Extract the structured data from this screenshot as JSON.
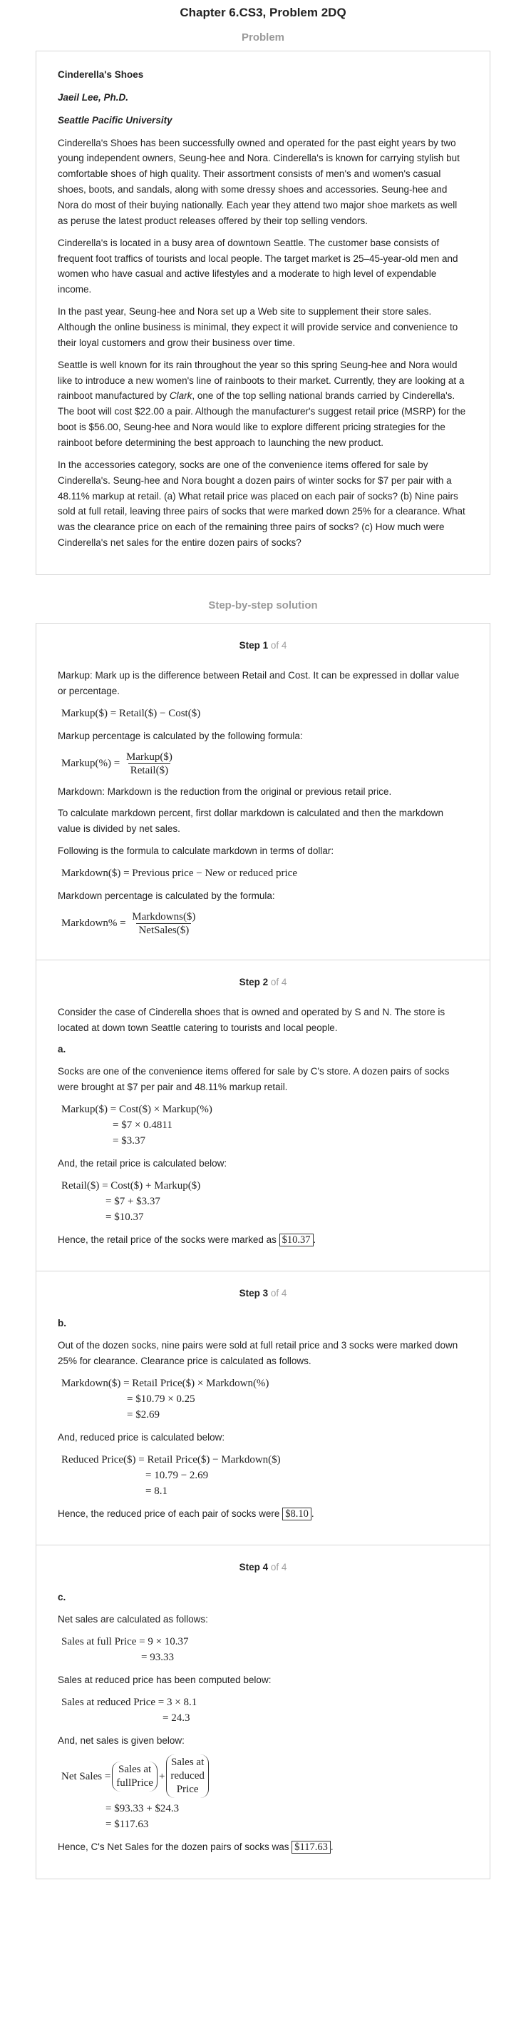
{
  "page_title": "Chapter 6.CS3, Problem 2DQ",
  "problem_heading": "Problem",
  "problem": {
    "title": "Cinderella's Shoes",
    "author": "Jaeil Lee, Ph.D.",
    "affiliation": "Seattle Pacific University",
    "p1": "Cinderella's Shoes has been successfully owned and operated for the past eight years by two young independent owners, Seung-hee and Nora. Cinderella's is known for carrying stylish but comfortable shoes of high quality. Their assortment consists of men's and women's casual shoes, boots, and sandals, along with some dressy shoes and accessories. Seung-hee and Nora do most of their buying nationally. Each year they attend two major shoe markets as well as peruse the latest product releases offered by their top selling vendors.",
    "p2": "Cinderella's is located in a busy area of downtown Seattle. The customer base consists of frequent foot traffics of tourists and local people. The target market is 25–45-year-old men and women who have casual and active lifestyles and a moderate to high level of expendable income.",
    "p3": "In the past year, Seung-hee and Nora set up a Web site to supplement their store sales. Although the online business is minimal, they expect it will provide service and convenience to their loyal customers and grow their business over time.",
    "p4a": "Seattle is well known for its rain throughout the year so this spring Seung-hee and Nora would like to introduce a new women's line of rainboots to their market. Currently, they are looking at a rainboot manufactured by ",
    "p4b": "Clark",
    "p4c": ", one of the top selling national brands carried by Cinderella's. The boot will cost $22.00 a pair. Although the manufacturer's suggest retail price (MSRP) for the boot is $56.00, Seung-hee and Nora would like to explore different pricing strategies for the rainboot before determining the best approach to launching the new product.",
    "p5": "In the accessories category, socks are one of the convenience items offered for sale by Cinderella's. Seung-hee and Nora bought a dozen pairs of winter socks for $7 per pair with a 48.11% markup at retail. (a) What retail price was placed on each pair of socks? (b) Nine pairs sold at full retail, leaving three pairs of socks that were marked down 25% for a clearance. What was the clearance price on each of the remaining three pairs of socks? (c) How much were Cinderella's net sales for the entire dozen pairs of socks?"
  },
  "solution_heading": "Step-by-step solution",
  "step_word": "Step",
  "step_of": "of 4",
  "steps": [
    {
      "num": "1",
      "t1": "Markup: Mark up is the difference between Retail and Cost. It can be expressed in dollar value or percentage.",
      "eq1": "Markup($) = Retail($) − Cost($)",
      "t2": "Markup percentage is calculated by the following formula:",
      "eq2_lhs": "Markup(%) =",
      "eq2_num": "Markup($)",
      "eq2_den": "Retail($)",
      "t3": "Markdown: Markdown is the reduction from the original or previous retail price.",
      "t4": "To calculate markdown percent, first dollar markdown is calculated and then the markdown value is divided by net sales.",
      "t5": "Following is the formula to calculate markdown in terms of dollar:",
      "eq3": "Markdown($) = Previous price − New or reduced price",
      "t6": "Markdown percentage is calculated by the formula:",
      "eq4_lhs": "Markdown% =",
      "eq4_num": "Markdowns($)",
      "eq4_den": "NetSales($)"
    },
    {
      "num": "2",
      "t1": "Consider the case of Cinderella shoes that is owned and operated by S and N. The store is located at down town Seattle catering to tourists and local people.",
      "label": "a.",
      "t2": "Socks are one of the convenience items offered for sale by C's store. A dozen pairs of socks were brought at $7 per pair and 48.11% markup retail.",
      "eq1": "Markup($) = Cost($) × Markup(%)",
      "eq2": "= $7 × 0.4811",
      "eq3": "= $3.37",
      "t3": "And, the retail price is calculated below:",
      "eq4": "Retail($) = Cost($) + Markup($)",
      "eq5": "= $7 + $3.37",
      "eq6": "= $10.37",
      "ans_text": "Hence, the retail price of the socks were marked as",
      "ans_val": "$10.37"
    },
    {
      "num": "3",
      "label": "b.",
      "t1": "Out of the dozen socks, nine pairs were sold at full retail price and 3 socks were marked down 25% for clearance. Clearance price is calculated as follows.",
      "eq1": "Markdown($) = Retail Price($) × Markdown(%)",
      "eq2": "= $10.79 × 0.25",
      "eq3": "= $2.69",
      "t2": "And, reduced price is calculated below:",
      "eq4": "Reduced Price($) = Retail Price($) − Markdown($)",
      "eq5": "= 10.79 − 2.69",
      "eq6": "= 8.1",
      "ans_text": "Hence, the reduced price of each pair of socks were",
      "ans_val": "$8.10"
    },
    {
      "num": "4",
      "label": "c.",
      "t1": "Net sales are calculated as follows:",
      "eq1": "Sales at full Price = 9 × 10.37",
      "eq2": "= 93.33",
      "t2": "Sales at reduced price has been computed below:",
      "eq3": "Sales at reduced Price = 3 × 8.1",
      "eq4": "= 24.3",
      "t3": "And, net sales is given below:",
      "ns_lhs": "Net Sales =",
      "ns_a1": "Sales at",
      "ns_a2": "fullPrice",
      "ns_b1": "Sales at",
      "ns_b2": "reduced",
      "ns_b3": "Price",
      "eq5": "= $93.33 + $24.3",
      "eq6": "= $117.63",
      "ans_text": "Hence, C's Net Sales for the dozen pairs of socks was",
      "ans_val": "$117.63"
    }
  ]
}
